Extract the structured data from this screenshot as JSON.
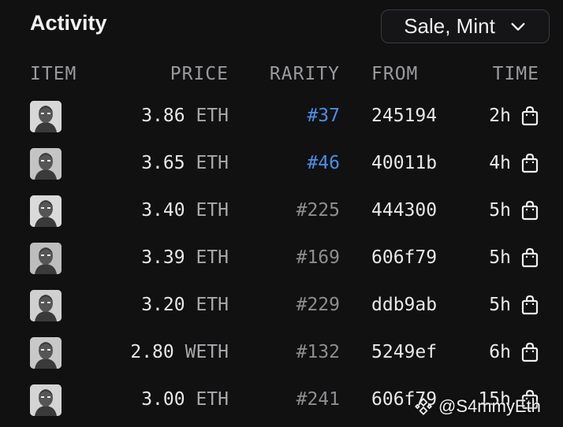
{
  "header": {
    "title": "Activity",
    "filter_label": "Sale, Mint"
  },
  "columns": {
    "item": "ITEM",
    "price": "PRICE",
    "rarity": "RARITY",
    "from": "FROM",
    "time": "TIME"
  },
  "rows": [
    {
      "price": "3.86",
      "unit": "ETH",
      "rarity": "#37",
      "from": "245194",
      "time": "2h"
    },
    {
      "price": "3.65",
      "unit": "ETH",
      "rarity": "#46",
      "from": "40011b",
      "time": "4h"
    },
    {
      "price": "3.40",
      "unit": "ETH",
      "rarity": "#225",
      "from": "444300",
      "time": "5h"
    },
    {
      "price": "3.39",
      "unit": "ETH",
      "rarity": "#169",
      "from": "606f79",
      "time": "5h"
    },
    {
      "price": "3.20",
      "unit": "ETH",
      "rarity": "#229",
      "from": "ddb9ab",
      "time": "5h"
    },
    {
      "price": "2.80",
      "unit": "WETH",
      "rarity": "#132",
      "from": "5249ef",
      "time": "6h"
    },
    {
      "price": "3.00",
      "unit": "ETH",
      "rarity": "#241",
      "from": "606f79",
      "time": "15h"
    }
  ],
  "watermark": "@S4mmyEth",
  "colors": {
    "background": "#111112",
    "rarity_highlight": "#4a8fe6",
    "rarity_normal": "#8e8e92"
  },
  "icons": {
    "filter": "chevron-down-icon",
    "time": "shopping-bag-icon",
    "watermark": "binance-icon"
  }
}
